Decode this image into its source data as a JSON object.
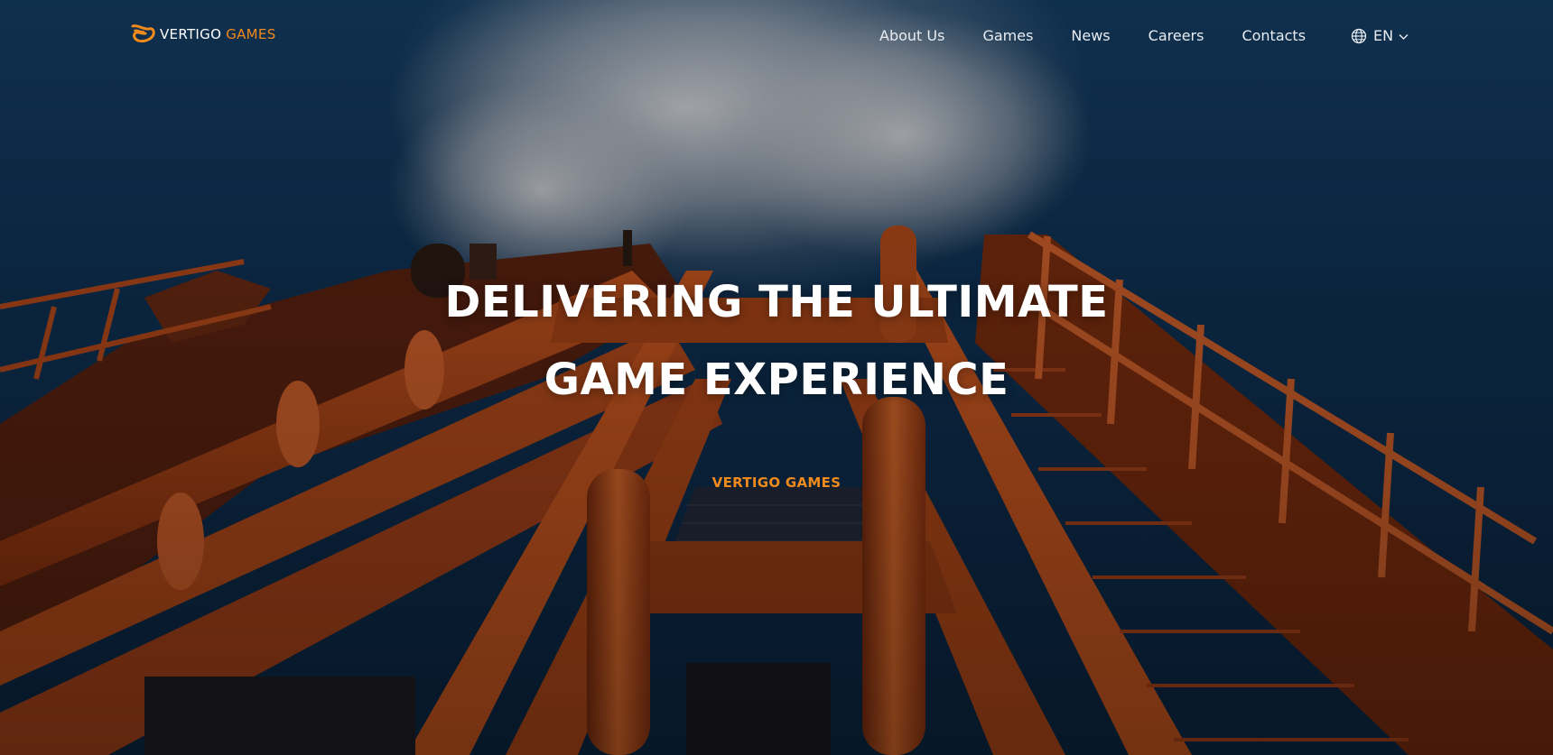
{
  "header": {
    "logo": {
      "word1": "VERTIGO",
      "word2": "GAMES",
      "icon": "vertigo-swirl-logo"
    },
    "nav": [
      {
        "label": "About Us"
      },
      {
        "label": "Games"
      },
      {
        "label": "News"
      },
      {
        "label": "Careers"
      },
      {
        "label": "Contacts"
      }
    ],
    "language": {
      "icon": "globe-icon",
      "selected": "EN",
      "dropdown_icon": "chevron-down-icon"
    }
  },
  "hero": {
    "title_line1": "DELIVERING THE ULTIMATE",
    "title_line2": "GAME EXPERIENCE",
    "subtitle": "VERTIGO GAMES"
  },
  "colors": {
    "accent": "#f08a1c",
    "text": "#ffffff",
    "sky": "#0f3255",
    "structure": "#c8561f"
  }
}
